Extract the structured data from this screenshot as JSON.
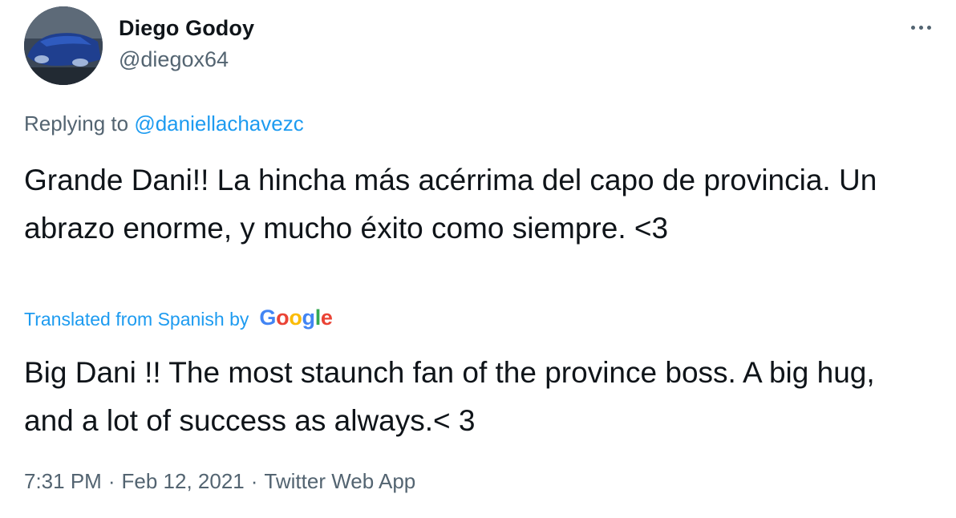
{
  "author": {
    "name": "Diego Godoy",
    "handle": "@diegox64"
  },
  "more_icon": "more-horizontal-icon",
  "reply": {
    "prefix": "Replying to",
    "mention": "@daniellachavezc"
  },
  "tweet": {
    "original_text": "Grande Dani!! La hincha más acérrima del capo de provincia. Un abrazo enorme, y mucho éxito como siempre. <3",
    "translated_label": "Translated from Spanish by",
    "translation_provider": [
      "G",
      "o",
      "o",
      "g",
      "l",
      "e"
    ],
    "translated_text": "Big Dani !! The most staunch fan of the province boss. A big hug, and a lot of success as always.< 3"
  },
  "meta": {
    "time": "7:31 PM",
    "date": "Feb 12, 2021",
    "source": "Twitter Web App",
    "separator": "·"
  },
  "colors": {
    "accent": "#1d9bf0",
    "secondary_text": "#536471",
    "primary_text": "#0f1419"
  }
}
